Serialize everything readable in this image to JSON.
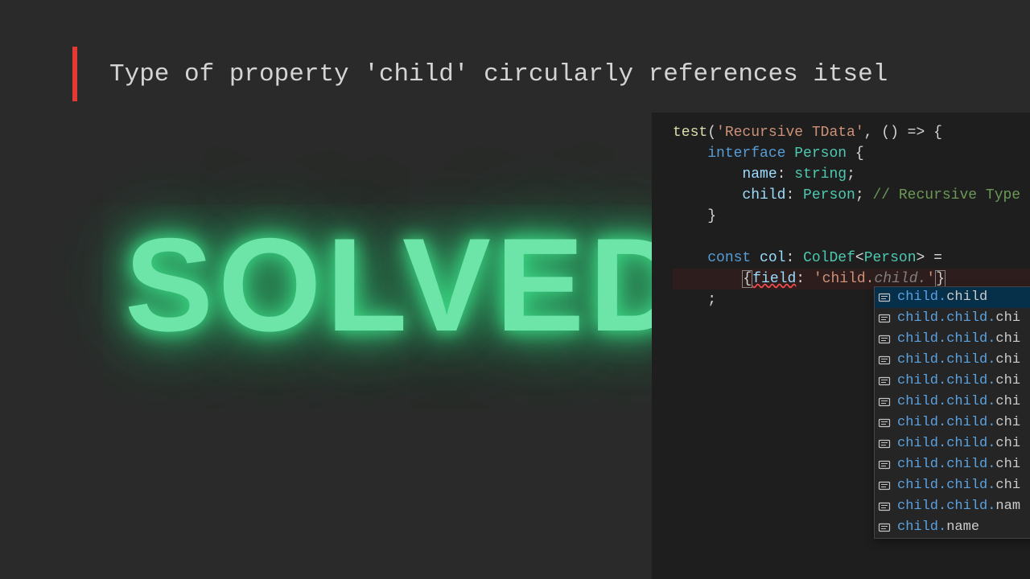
{
  "error_message": "Type of property 'child' circularly references itsel",
  "solved_text": "SOLVED",
  "code": {
    "test_fn": "test",
    "test_label": "'Recursive TData'",
    "arrow_args": "() => {",
    "interface_kw": "interface",
    "interface_name": "Person",
    "brace_open": "{",
    "name_prop": "name",
    "name_type": "string",
    "child_prop": "child",
    "child_type": "Person",
    "child_comment": "// Recursive Type",
    "brace_close": "}",
    "const_kw": "const",
    "col_name": "col",
    "colon": ":",
    "coldef": "ColDef",
    "generic": "Person",
    "assign": "=",
    "field_obj_open": "{",
    "field_key": "field",
    "field_val_q": "'",
    "field_val_match": "child.",
    "field_val_ital": "child.",
    "field_obj_close": "}",
    "semi": ";"
  },
  "suggestions": [
    {
      "match": "child.",
      "tail": "child",
      "selected": true
    },
    {
      "match": "child.child.",
      "tail": "chi",
      "selected": false
    },
    {
      "match": "child.child.",
      "tail": "chi",
      "selected": false
    },
    {
      "match": "child.child.",
      "tail": "chi",
      "selected": false
    },
    {
      "match": "child.child.",
      "tail": "chi",
      "selected": false
    },
    {
      "match": "child.child.",
      "tail": "chi",
      "selected": false
    },
    {
      "match": "child.child.",
      "tail": "chi",
      "selected": false
    },
    {
      "match": "child.child.",
      "tail": "chi",
      "selected": false
    },
    {
      "match": "child.child.",
      "tail": "chi",
      "selected": false
    },
    {
      "match": "child.child.",
      "tail": "chi",
      "selected": false
    },
    {
      "match": "child.child.",
      "tail": "nam",
      "selected": false
    },
    {
      "match": "child.",
      "tail": "name",
      "selected": false
    }
  ]
}
